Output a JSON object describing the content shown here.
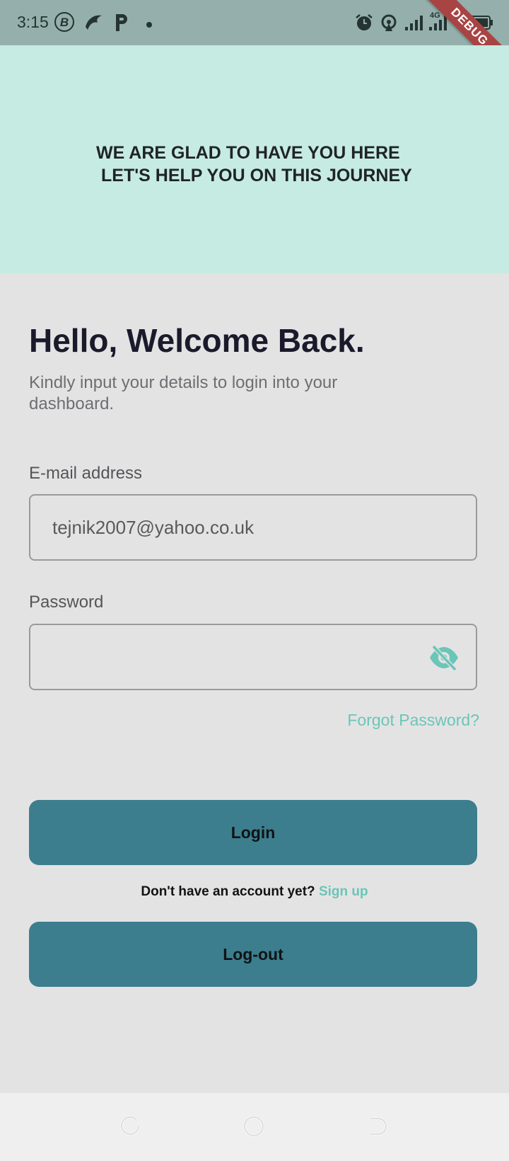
{
  "status_bar": {
    "time": "3:15",
    "network": "4G",
    "debug_banner": "DEBUG",
    "icons": [
      "bitcoin-icon",
      "bird-icon",
      "p-icon",
      "dot-icon",
      "alarm-icon",
      "hotspot-icon",
      "signal-icon",
      "signal-4g-icon",
      "battery-icon"
    ]
  },
  "hero": {
    "line1": "WE ARE GLAD TO HAVE YOU HERE",
    "line2": "LET'S HELP YOU ON THIS JOURNEY"
  },
  "login": {
    "title": "Hello, Welcome Back.",
    "subtitle": "Kindly input your details to login into your dashboard.",
    "email_label": "E-mail address",
    "email_value": "tejnik2007@yahoo.co.uk",
    "password_label": "Password",
    "password_value": "",
    "forgot_password": "Forgot Password?",
    "login_button": "Login",
    "no_account_text": "Don't have an account yet?",
    "signup_link": "Sign up",
    "logout_button": "Log-out"
  },
  "nav_bar": {
    "icons": [
      "recents-icon",
      "home-icon",
      "back-icon"
    ]
  },
  "colors": {
    "accent": "#6ac6b7",
    "button": "#3c7e8e",
    "hero_bg": "#c6ebe3",
    "page_bg": "#e4e3e4"
  }
}
